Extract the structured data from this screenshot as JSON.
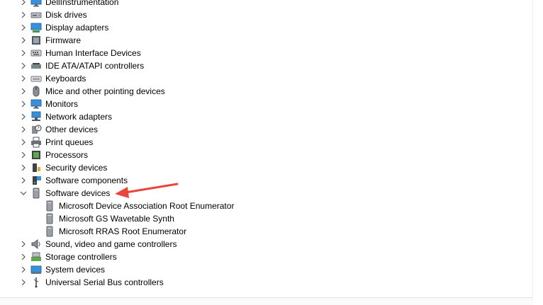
{
  "tree": {
    "items": [
      {
        "label": "DellInstrumentation",
        "icon": "monitor-icon",
        "expanded": false
      },
      {
        "label": "Disk drives",
        "icon": "disk-drive-icon",
        "expanded": false
      },
      {
        "label": "Display adapters",
        "icon": "display-adapter-icon",
        "expanded": false
      },
      {
        "label": "Firmware",
        "icon": "firmware-icon",
        "expanded": false
      },
      {
        "label": "Human Interface Devices",
        "icon": "hid-icon",
        "expanded": false
      },
      {
        "label": "IDE ATA/ATAPI controllers",
        "icon": "ide-controller-icon",
        "expanded": false
      },
      {
        "label": "Keyboards",
        "icon": "keyboard-icon",
        "expanded": false
      },
      {
        "label": "Mice and other pointing devices",
        "icon": "mouse-icon",
        "expanded": false
      },
      {
        "label": "Monitors",
        "icon": "monitor-icon",
        "expanded": false
      },
      {
        "label": "Network adapters",
        "icon": "network-adapter-icon",
        "expanded": false
      },
      {
        "label": "Other devices",
        "icon": "unknown-device-icon",
        "expanded": false
      },
      {
        "label": "Print queues",
        "icon": "printer-icon",
        "expanded": false
      },
      {
        "label": "Processors",
        "icon": "processor-icon",
        "expanded": false
      },
      {
        "label": "Security devices",
        "icon": "security-device-icon",
        "expanded": false
      },
      {
        "label": "Software components",
        "icon": "software-component-icon",
        "expanded": false
      },
      {
        "label": "Software devices",
        "icon": "software-device-icon",
        "expanded": true
      },
      {
        "label": "Microsoft Device Association Root Enumerator",
        "icon": "software-device-icon",
        "child": true
      },
      {
        "label": "Microsoft GS Wavetable Synth",
        "icon": "software-device-icon",
        "child": true
      },
      {
        "label": "Microsoft RRAS Root Enumerator",
        "icon": "software-device-icon",
        "child": true
      },
      {
        "label": "Sound, video and game controllers",
        "icon": "speaker-icon",
        "expanded": false
      },
      {
        "label": "Storage controllers",
        "icon": "storage-controller-icon",
        "expanded": false
      },
      {
        "label": "System devices",
        "icon": "system-device-icon",
        "expanded": false
      },
      {
        "label": "Universal Serial Bus controllers",
        "icon": "usb-icon",
        "expanded": false
      }
    ]
  },
  "colors": {
    "annotation_arrow": "#e8453c",
    "chevron": "#555555",
    "icon_blue": "#3a8fd6",
    "icon_gray": "#8a8f96"
  }
}
